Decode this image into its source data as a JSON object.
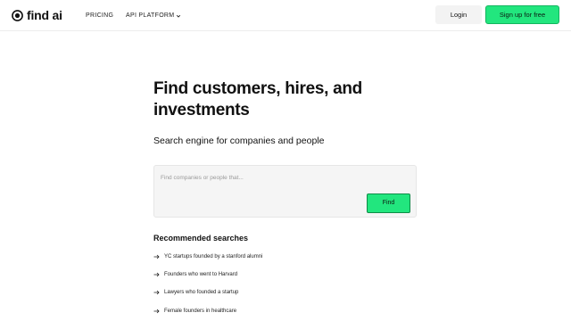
{
  "brand": {
    "name": "find ai",
    "logo_icon": "find-ai-logo-icon"
  },
  "nav": {
    "pricing": "PRICING",
    "api_platform": "API PLATFORM",
    "api_platform_icon": "chevron-down-icon"
  },
  "auth": {
    "login": "Login",
    "signup": "Sign up for free"
  },
  "hero": {
    "title": "Find customers, hires, and investments",
    "subtitle": "Search engine for companies and people"
  },
  "search": {
    "placeholder": "Find companies or people that...",
    "value": "",
    "button_label": "Find"
  },
  "recommended": {
    "heading": "Recommended searches",
    "item_icon": "arrow-right-icon",
    "items": [
      {
        "label": "YC startups founded by a stanford alumni"
      },
      {
        "label": "Founders who went to Harvard"
      },
      {
        "label": "Lawyers who founded a startup"
      },
      {
        "label": "Female founders in healthcare"
      }
    ]
  },
  "colors": {
    "accent_green": "#22e67e",
    "accent_border": "#0f8c47",
    "text": "#111111",
    "muted": "#9a9a9a",
    "surface": "#f5f5f5"
  }
}
